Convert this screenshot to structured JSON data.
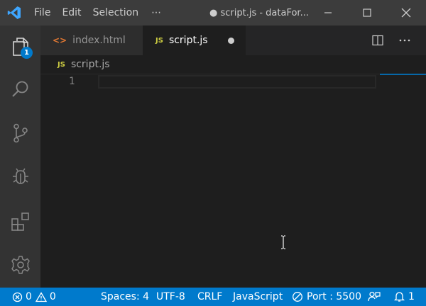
{
  "titlebar": {
    "menu": [
      "File",
      "Edit",
      "Selection"
    ],
    "more": "⋯",
    "window_title": "● script.js - dataFor..."
  },
  "activity": {
    "explorer_badge": "1"
  },
  "tabs": [
    {
      "label": "index.html",
      "icon": "html-file-icon"
    },
    {
      "label": "script.js",
      "icon": "js-file-icon",
      "js_badge": "JS",
      "modified": true
    }
  ],
  "breadcrumb": {
    "js_badge": "JS",
    "file": "script.js"
  },
  "editor": {
    "line_numbers": [
      "1"
    ]
  },
  "statusbar": {
    "errors": "0",
    "warnings": "0",
    "spaces": "Spaces: 4",
    "encoding": "UTF-8",
    "eol": "CRLF",
    "language": "JavaScript",
    "port": "Port : 5500",
    "notifications": "1"
  },
  "colors": {
    "accent": "#007acc",
    "titlebar": "#3c3c3c",
    "activitybar": "#333333",
    "editor": "#1e1e1e",
    "js_yellow": "#cbcb41",
    "html_orange": "#e37933"
  }
}
